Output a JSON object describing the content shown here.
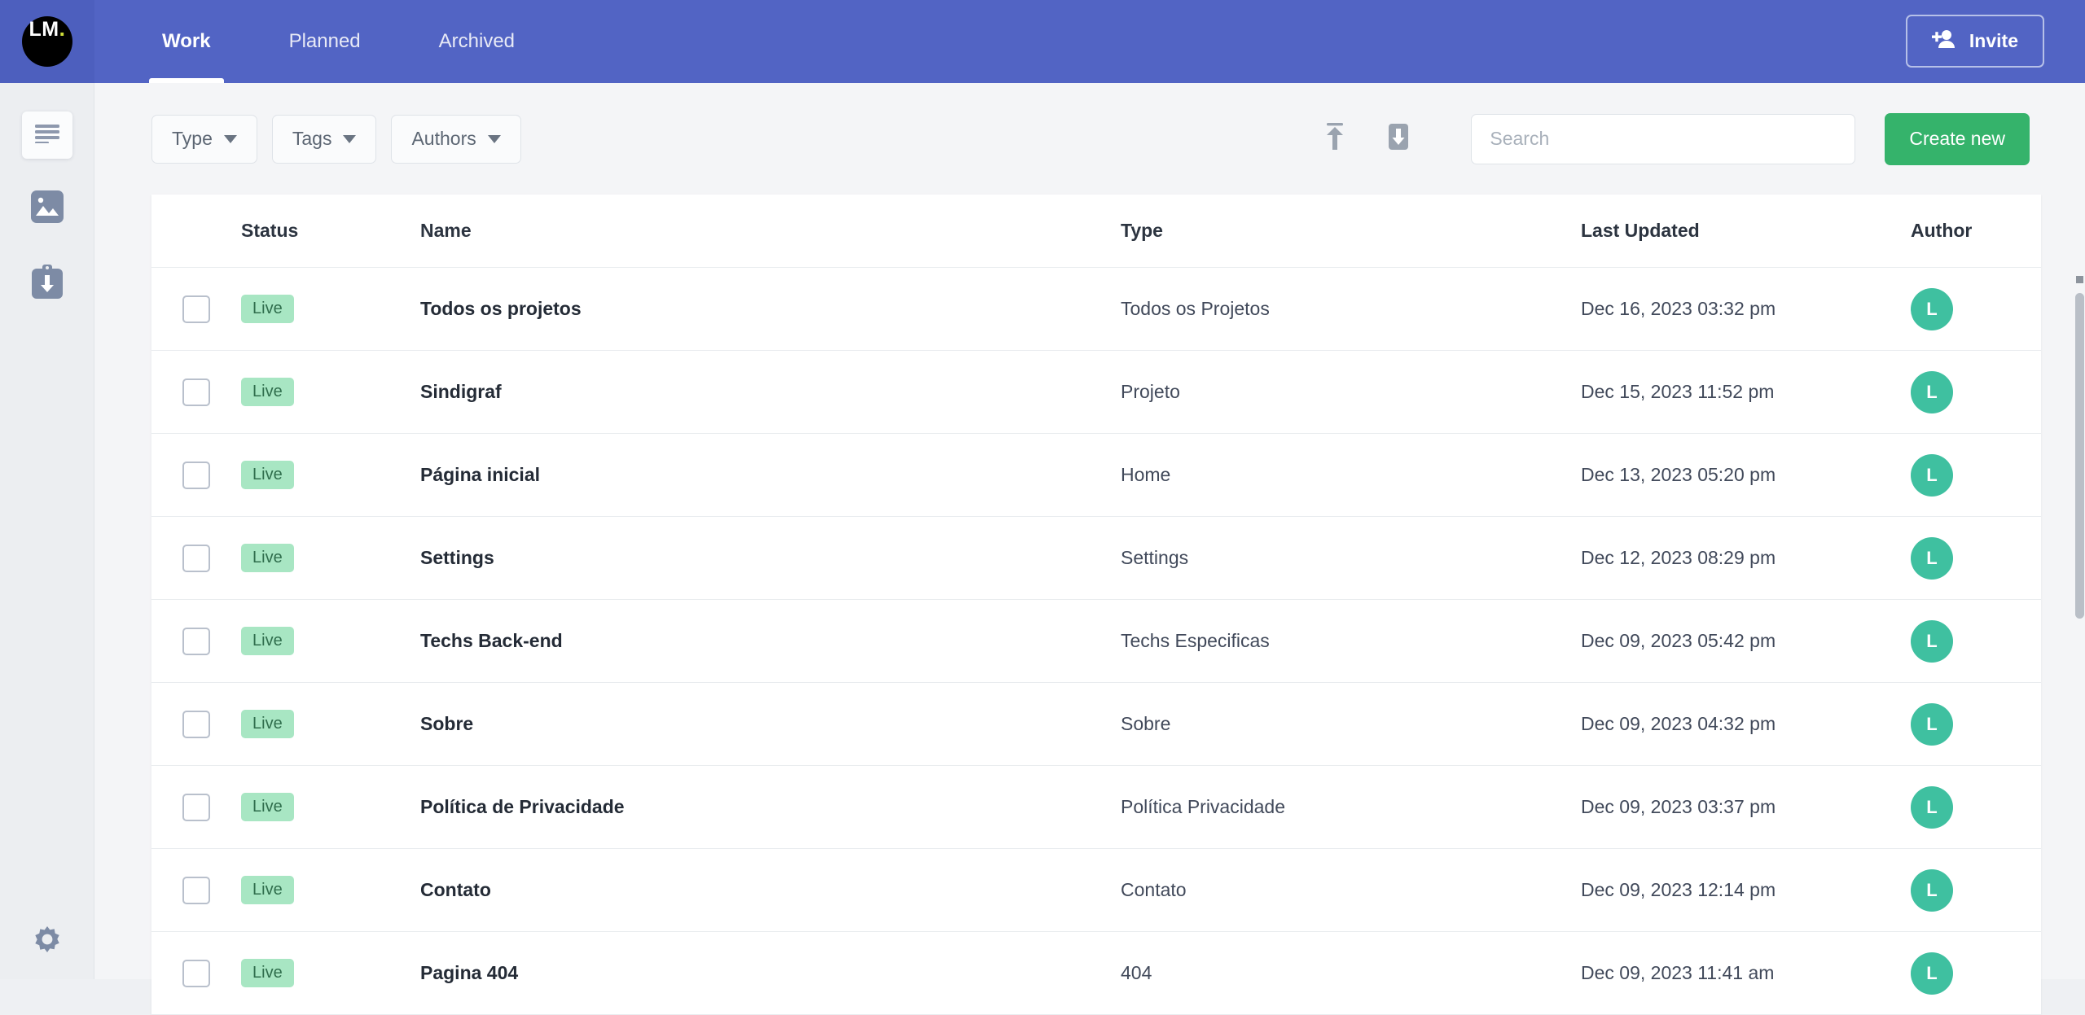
{
  "brand": {
    "logo_text": "LM",
    "logo_dot": ".",
    "logo_bg": "#000000",
    "logo_dot_color": "#cddc39",
    "header_bg": "#5264c4",
    "accent_green": "#35b36b",
    "avatar_color": "#3fc0a0",
    "badge_bg": "#a8e6c3"
  },
  "header": {
    "tabs": [
      {
        "label": "Work",
        "active": true
      },
      {
        "label": "Planned",
        "active": false
      },
      {
        "label": "Archived",
        "active": false
      }
    ],
    "invite_label": "Invite",
    "invite_icon": "person-add-icon"
  },
  "sidebar": {
    "items": [
      {
        "name": "pages",
        "icon": "document-lines-icon",
        "active": true
      },
      {
        "name": "media",
        "icon": "image-icon",
        "active": false
      },
      {
        "name": "assets",
        "icon": "clipboard-download-icon",
        "active": false
      }
    ],
    "footer_item": {
      "name": "settings",
      "icon": "gear-icon"
    }
  },
  "toolbar": {
    "filters": [
      {
        "label": "Type",
        "icon": "chevron-down-icon"
      },
      {
        "label": "Tags",
        "icon": "chevron-down-icon"
      },
      {
        "label": "Authors",
        "icon": "chevron-down-icon"
      }
    ],
    "icons": [
      {
        "name": "upload-icon"
      },
      {
        "name": "download-icon"
      }
    ],
    "search": {
      "placeholder": "Search",
      "value": ""
    },
    "create_label": "Create new"
  },
  "table": {
    "columns": [
      "Status",
      "Name",
      "Type",
      "Last Updated",
      "Author"
    ],
    "rows": [
      {
        "status": "Live",
        "name": "Todos os projetos",
        "type": "Todos os Projetos",
        "updated": "Dec 16, 2023 03:32 pm",
        "author": "L",
        "checked": false
      },
      {
        "status": "Live",
        "name": "Sindigraf",
        "type": "Projeto",
        "updated": "Dec 15, 2023 11:52 pm",
        "author": "L",
        "checked": false
      },
      {
        "status": "Live",
        "name": "Página inicial",
        "type": "Home",
        "updated": "Dec 13, 2023 05:20 pm",
        "author": "L",
        "checked": false
      },
      {
        "status": "Live",
        "name": "Settings",
        "type": "Settings",
        "updated": "Dec 12, 2023 08:29 pm",
        "author": "L",
        "checked": false
      },
      {
        "status": "Live",
        "name": "Techs Back-end",
        "type": "Techs Especificas",
        "updated": "Dec 09, 2023 05:42 pm",
        "author": "L",
        "checked": false
      },
      {
        "status": "Live",
        "name": "Sobre",
        "type": "Sobre",
        "updated": "Dec 09, 2023 04:32 pm",
        "author": "L",
        "checked": false
      },
      {
        "status": "Live",
        "name": "Política de Privacidade",
        "type": "Política Privacidade",
        "updated": "Dec 09, 2023 03:37 pm",
        "author": "L",
        "checked": false
      },
      {
        "status": "Live",
        "name": "Contato",
        "type": "Contato",
        "updated": "Dec 09, 2023 12:14 pm",
        "author": "L",
        "checked": false
      },
      {
        "status": "Live",
        "name": "Pagina 404",
        "type": "404",
        "updated": "Dec 09, 2023 11:41 am",
        "author": "L",
        "checked": false
      }
    ]
  }
}
